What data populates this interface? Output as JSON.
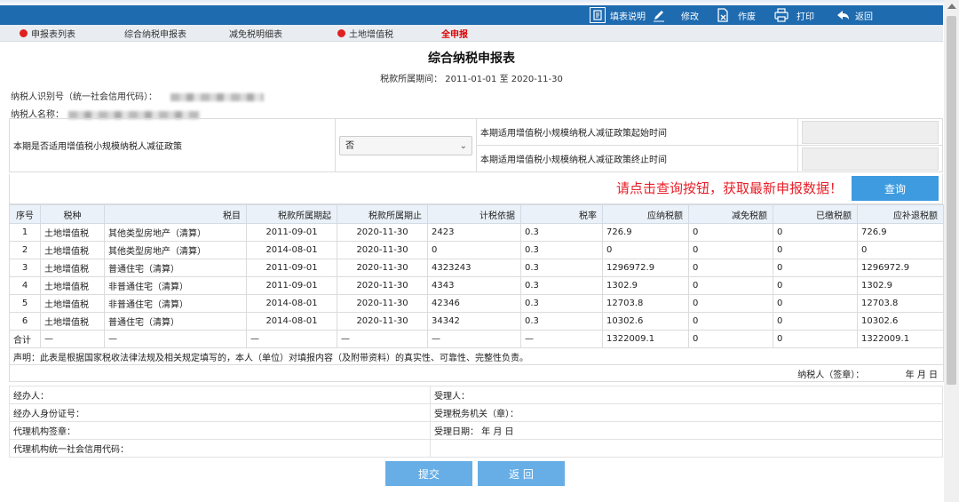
{
  "toolbar": {
    "items": [
      {
        "label": "填表说明",
        "icon": "document-icon"
      },
      {
        "label": "修改",
        "icon": "pencil-icon"
      },
      {
        "label": "作废",
        "icon": "void-document-icon"
      },
      {
        "label": "打印",
        "icon": "printer-icon"
      },
      {
        "label": "返回",
        "icon": "back-arrow-icon"
      }
    ]
  },
  "tabs": [
    {
      "label": "申报表列表",
      "dot": true
    },
    {
      "label": "综合纳税申报表",
      "dot": false
    },
    {
      "label": "减免税明细表",
      "dot": false
    },
    {
      "label": "土地增值税",
      "dot": true
    },
    {
      "label": "全申报",
      "dot": false,
      "active": true
    }
  ],
  "form": {
    "title": "综合纳税申报表",
    "period": "税款所属期间： 2011-01-01 至 2020-11-30",
    "taxpayer_id_label": "纳税人识别号（统一社会信用代码）：",
    "taxpayer_name_label": "纳税人名称："
  },
  "policy": {
    "question": "本期是否适用增值税小规模纳税人减征政策",
    "select_value": "否",
    "start_label": "本期适用增值税小规模纳税人减征政策起始时间",
    "end_label": "本期适用增值税小规模纳税人减征政策终止时间"
  },
  "notice": {
    "message": "请点击查询按钮，获取最新申报数据！",
    "query_button": "查询"
  },
  "table": {
    "headers": [
      "序号",
      "税种",
      "税目",
      "税款所属期起",
      "税款所属期止",
      "计税依据",
      "税率",
      "应纳税额",
      "减免税额",
      "已缴税额",
      "应补退税额"
    ],
    "rows": [
      [
        "1",
        "土地增值税",
        "其他类型房地产（清算）",
        "2011-09-01",
        "2020-11-30",
        "2423",
        "0.3",
        "726.9",
        "0",
        "0",
        "726.9"
      ],
      [
        "2",
        "土地增值税",
        "其他类型房地产（清算）",
        "2014-08-01",
        "2020-11-30",
        "0",
        "0.3",
        "0",
        "0",
        "0",
        "0"
      ],
      [
        "3",
        "土地增值税",
        "普通住宅（清算）",
        "2011-09-01",
        "2020-11-30",
        "4323243",
        "0.3",
        "1296972.9",
        "0",
        "0",
        "1296972.9"
      ],
      [
        "4",
        "土地增值税",
        "非普通住宅（清算）",
        "2011-09-01",
        "2020-11-30",
        "4343",
        "0.3",
        "1302.9",
        "0",
        "0",
        "1302.9"
      ],
      [
        "5",
        "土地增值税",
        "非普通住宅（清算）",
        "2014-08-01",
        "2020-11-30",
        "42346",
        "0.3",
        "12703.8",
        "0",
        "0",
        "12703.8"
      ],
      [
        "6",
        "土地增值税",
        "普通住宅（清算）",
        "2014-08-01",
        "2020-11-30",
        "34342",
        "0.3",
        "10302.6",
        "0",
        "0",
        "10302.6"
      ]
    ],
    "total": [
      "合计",
      "—",
      "—",
      "—",
      "—",
      "—",
      "—",
      "1322009.1",
      "0",
      "0",
      "1322009.1"
    ],
    "declaration": "声明：此表是根据国家税收法律法规及相关规定填写的，本人（单位）对填报内容（及附带资料）的真实性、可靠性、完整性负责。",
    "sign_label": "纳税人（签章）：",
    "sign_date": "年 月 日"
  },
  "signatures": {
    "handler": "经办人：",
    "receiver": "受理人：",
    "handler_id": "经办人身份证号：",
    "tax_office": "受理税务机关（章）：",
    "agency_seal": "代理机构签章：",
    "accept_date": "受理日期：   年 月 日",
    "agency_code": "代理机构统一社会信用代码："
  },
  "buttons": {
    "submit": "提交",
    "back": "返 回"
  }
}
